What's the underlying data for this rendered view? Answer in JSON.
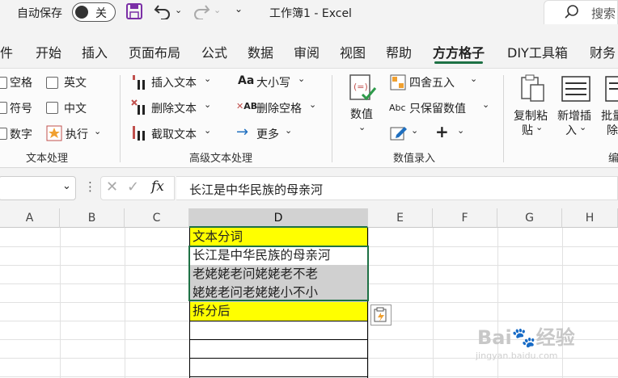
{
  "titlebar": {
    "autosave_label": "自动保存",
    "autosave_state": "关",
    "doc_title": "工作簿1 - Excel",
    "search_placeholder": "搜索"
  },
  "tabs": [
    "件",
    "开始",
    "插入",
    "页面布局",
    "公式",
    "数据",
    "审阅",
    "视图",
    "帮助",
    "方方格子",
    "DIY工具箱",
    "财务"
  ],
  "active_tab": "方方格子",
  "ribbon": {
    "text_group": {
      "label": "文本处理",
      "items": [
        "空格",
        "英文",
        "符号",
        "中文",
        "数字",
        "执行"
      ]
    },
    "adv_group": {
      "label": "高级文本处理",
      "items": [
        "插入文本",
        "大小写",
        "删除文本",
        "删除空格",
        "截取文本",
        "更多"
      ]
    },
    "num_group": {
      "label": "数值录入",
      "value_btn": "数值",
      "items": [
        "四舍五入",
        "只保留数值"
      ]
    },
    "edit_group": {
      "label": "编",
      "copy_btn": [
        "复制粘",
        "贴"
      ],
      "insert_btn": [
        "新增插",
        "入"
      ],
      "batch_btn": [
        "批量",
        "除"
      ]
    }
  },
  "formula_bar": {
    "fx": "fx",
    "content": "长江是中华民族的母亲河"
  },
  "grid": {
    "columns": [
      "A",
      "B",
      "C",
      "D",
      "E",
      "F",
      "G",
      "H"
    ],
    "selected_column": "D",
    "cells": [
      {
        "text": "文本分词",
        "fill": "yellow"
      },
      {
        "text": "长江是中华民族的母亲河",
        "fill": "white"
      },
      {
        "text": "老姥姥老问姥姥老不老",
        "fill": "gray"
      },
      {
        "text": "姥姥老问老姥姥小不小",
        "fill": "gray"
      },
      {
        "text": "拆分后",
        "fill": "yellow"
      },
      {
        "text": "",
        "fill": "white"
      },
      {
        "text": "",
        "fill": "white"
      },
      {
        "text": "",
        "fill": "white"
      }
    ]
  },
  "watermark": {
    "text": "Bai经验",
    "sub": "jingyan.baidu.com"
  }
}
